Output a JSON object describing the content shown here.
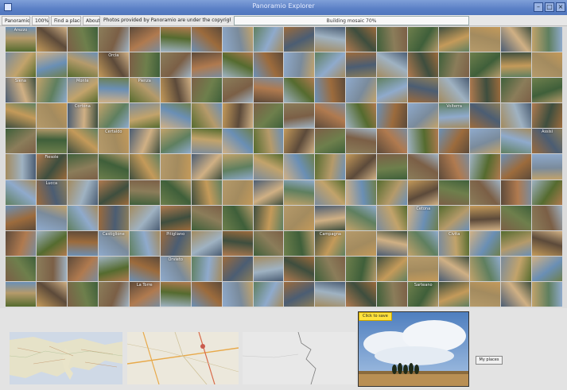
{
  "window": {
    "title": "Panoramio Explorer"
  },
  "toolbar": {
    "items": [
      "Panoramio",
      "100%",
      "Find a place",
      "About",
      "Photos provided by Panoramio are under the copyright of their owners",
      "Building mosaic 70%"
    ]
  },
  "grid": {
    "captions": [
      "Arezzo",
      "",
      "",
      "",
      "",
      "",
      "",
      "",
      "",
      "",
      "",
      "",
      "",
      "",
      "",
      "",
      "",
      "",
      "",
      "",
      "",
      "Orcia",
      "",
      "",
      "",
      "",
      "",
      "",
      "",
      "",
      "",
      "",
      "",
      "",
      "",
      "",
      "Siena",
      "",
      "Monte",
      "",
      "Pienza",
      "",
      "",
      "",
      "",
      "",
      "",
      "",
      "",
      "",
      "",
      "",
      "",
      "",
      "",
      "",
      "Cortona",
      "",
      "",
      "",
      "",
      "",
      "",
      "",
      "",
      "",
      "",
      "",
      "Volterra",
      "",
      "",
      "",
      "",
      "",
      "",
      "Certaldo",
      "",
      "",
      "",
      "",
      "",
      "",
      "",
      "",
      "",
      "",
      "",
      "",
      "",
      "Assisi",
      "",
      "Fiesole",
      "",
      "",
      "",
      "",
      "",
      "",
      "",
      "",
      "",
      "",
      "",
      "",
      "",
      "",
      "",
      "",
      "",
      "Lucca",
      "",
      "",
      "",
      "",
      "",
      "",
      "",
      "",
      "",
      "",
      "",
      "",
      "",
      "",
      "",
      "",
      "",
      "",
      "",
      "",
      "",
      "",
      "",
      "",
      "",
      "",
      "",
      "",
      "",
      "Cetona",
      "",
      "",
      "",
      "",
      "",
      "",
      "",
      "Castiglione",
      "",
      "Pitigliano",
      "",
      "",
      "",
      "",
      "Campagna",
      "",
      "",
      "",
      "Civita",
      "",
      "",
      "",
      "",
      "",
      "",
      "",
      "",
      "Orvieto",
      "",
      "",
      "",
      "",
      "",
      "",
      "",
      "",
      "",
      "",
      "",
      "",
      "",
      "",
      "",
      "",
      "La Torre",
      "",
      "",
      "",
      "",
      "",
      "",
      "",
      "",
      "Sarteano",
      "",
      "",
      "",
      ""
    ],
    "palette": [
      "#556b2f",
      "#8b7d5a",
      "#6a8fb5",
      "#9c6b3c",
      "#3f5f3a",
      "#b59a6a",
      "#7a8b9c",
      "#c49a5a",
      "#5c4a3a",
      "#8faacc",
      "#a38b5f",
      "#6e7f4c",
      "#4b5d73",
      "#d0b084",
      "#7b5f46",
      "#9fb2c2",
      "#5f7f5f",
      "#b07a4f",
      "#3e4e3e",
      "#c2a36b"
    ]
  },
  "bottom": {
    "click_label": "Click to save",
    "my_places": "My places"
  }
}
